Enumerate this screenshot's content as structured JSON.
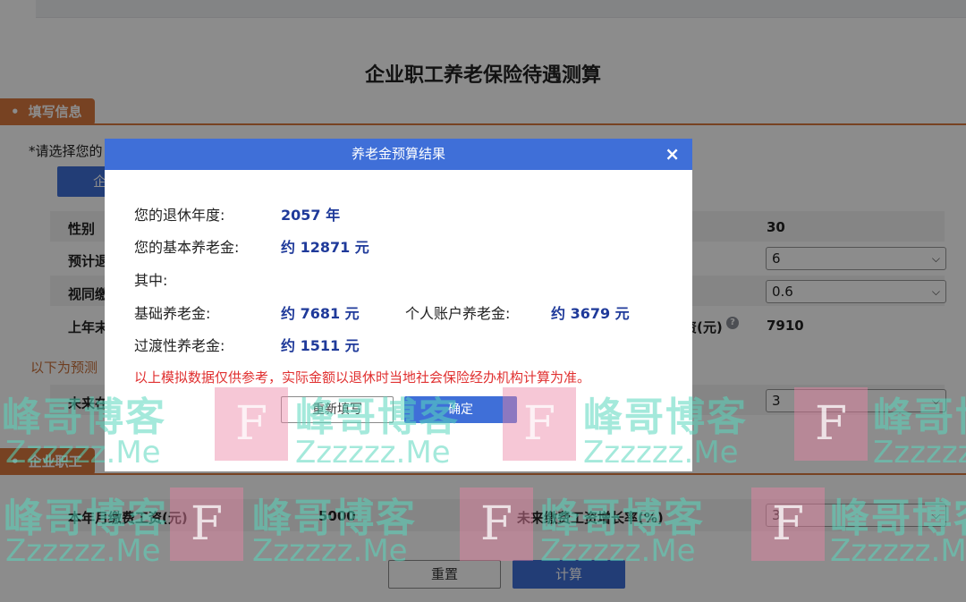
{
  "page": {
    "title": "企业职工养老保险待遇测算",
    "section_fill_tab": "填写信息",
    "section_employee_tab": "企业职工",
    "require_label_prefix": "*",
    "require_label": "请选择您的",
    "type_button_label": "企业",
    "pre_text": "以下为预测",
    "rows": [
      {
        "label": "性别",
        "right_value": "30"
      },
      {
        "label": "预计退",
        "right_select": "6"
      },
      {
        "label": "视同缴",
        "right_select": "0.6"
      },
      {
        "label": "上年末",
        "right_label": "资(元)",
        "right_value": "7910"
      },
      {
        "label": "未来在",
        "right_select": "3"
      }
    ],
    "bottom_row": {
      "label": "本年月缴费工资(元)",
      "value": "5000",
      "right_label": "未来缴费工资增长率(%)",
      "right_select": "3"
    },
    "reset_button": "重置",
    "calc_button": "计算"
  },
  "modal": {
    "title": "养老金预算结果",
    "close_icon": "×",
    "retire_year_label": "您的退休年度:",
    "retire_year_value": "2057 年",
    "basic_pension_label": "您的基本养老金:",
    "basic_pension_value": "约 12871 元",
    "among_label": "其中:",
    "base_pension_label": "基础养老金:",
    "base_pension_value": "约 7681 元",
    "personal_account_label": "个人账户养老金:",
    "personal_account_value": "约 3679 元",
    "transition_label": "过渡性养老金:",
    "transition_value": "约 1511 元",
    "warning": "以上模拟数据仅供参考，实际金额以退休时当地社会保险经办机构计算为准。",
    "refill_button": "重新填写",
    "ok_button": "确定"
  },
  "watermark": {
    "cn": "峰哥博客",
    "en": "Zzzzzz.Me",
    "f": "F"
  },
  "colors": {
    "accent_blue": "#3f6fd8",
    "section_orange": "#d9783f",
    "value_blue": "#1f3a9a",
    "warning_red": "#e03030"
  }
}
